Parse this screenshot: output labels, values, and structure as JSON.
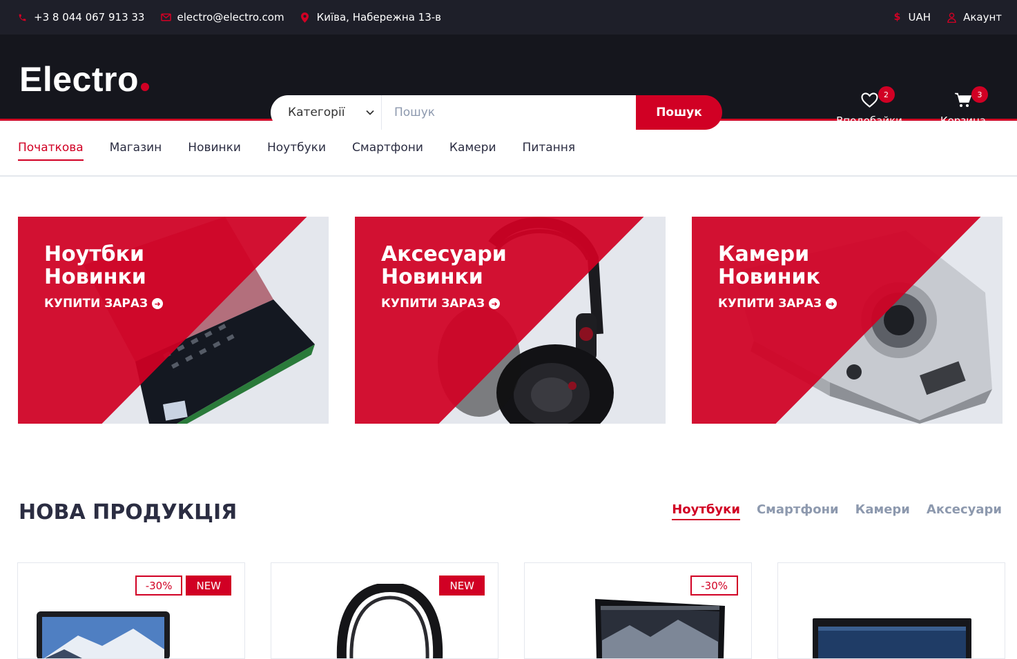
{
  "topbar": {
    "phone": "+3 8 044 067 913 33",
    "email": "electro@electro.com",
    "address": "Київа, Набережна 13-в",
    "currency": "UAH",
    "account": "Акаунт"
  },
  "header": {
    "logo": "Electro",
    "search": {
      "category_label": "Категорії",
      "placeholder": "Пошук",
      "button": "Пошук"
    },
    "wishlist": {
      "label": "Вподобайки",
      "count": "2"
    },
    "cart": {
      "label": "Корзина",
      "count": "3"
    }
  },
  "nav": {
    "items": [
      {
        "label": "Початкова",
        "active": true
      },
      {
        "label": "Магазин"
      },
      {
        "label": "Новинки"
      },
      {
        "label": "Ноутбуки"
      },
      {
        "label": "Смартфони"
      },
      {
        "label": "Камери"
      },
      {
        "label": "Питання"
      }
    ]
  },
  "promos": [
    {
      "line1": "Ноутбки",
      "line2": "Новинки",
      "cta": "КУПИТИ ЗАРАЗ",
      "image": "laptop-image"
    },
    {
      "line1": "Аксесуари",
      "line2": "Новинки",
      "cta": "КУПИТИ ЗАРАЗ",
      "image": "headphones-image"
    },
    {
      "line1": "Камери",
      "line2": "Новиник",
      "cta": "КУПИТИ ЗАРАЗ",
      "image": "camera-image"
    }
  ],
  "section": {
    "title": "НОВА ПРОДУКЦІЯ",
    "tabs": [
      {
        "label": "Ноутбуки",
        "active": true
      },
      {
        "label": "Смартфони"
      },
      {
        "label": "Камери"
      },
      {
        "label": "Аксесуари"
      }
    ]
  },
  "products": [
    {
      "sale": "-30%",
      "new": "NEW"
    },
    {
      "new": "NEW"
    },
    {
      "sale": "-30%"
    },
    {}
  ],
  "colors": {
    "accent": "#d10024",
    "dark": "#15161d",
    "topbar": "#1e1f29",
    "muted": "#8d99ae"
  }
}
